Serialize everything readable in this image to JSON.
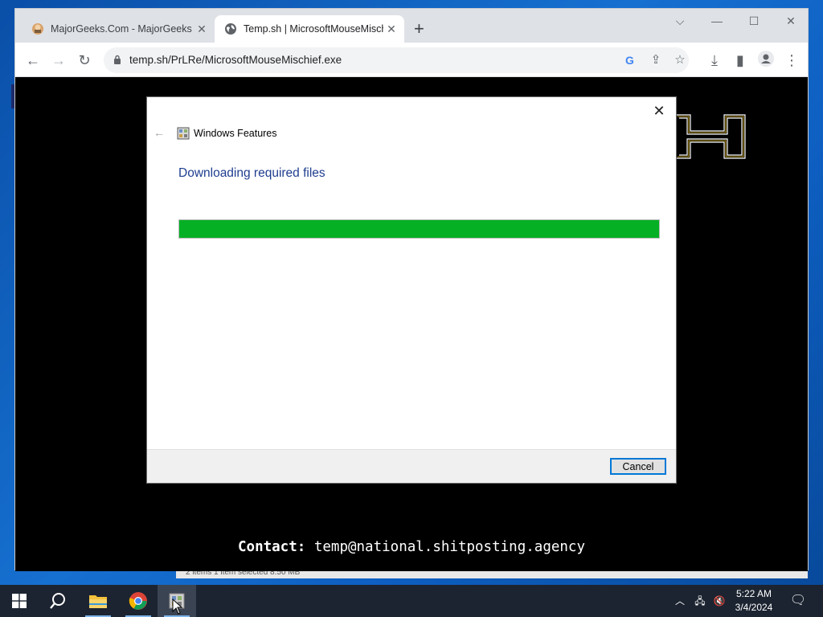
{
  "browser": {
    "tabs": [
      {
        "title": "MajorGeeks.Com - MajorGeeks",
        "active": false
      },
      {
        "title": "Temp.sh | MicrosoftMouseMischief.exe",
        "active": true
      }
    ],
    "url": "temp.sh/PrLRe/MicrosoftMouseMischief.exe",
    "contact_label": "Contact:",
    "contact_email": "temp@national.shitposting.agency"
  },
  "dialog": {
    "title": "Windows Features",
    "heading": "Downloading required files",
    "progress": 1.0,
    "cancel_label": "Cancel"
  },
  "background_window": {
    "status_text": "2 items    1 item selected  8.50 MB"
  },
  "taskbar": {
    "time": "5:22 AM",
    "date": "3/4/2024"
  },
  "colors": {
    "progress_fill": "#06b025",
    "dialog_heading": "#1e3d8f",
    "taskbar_bg": "#1c2431",
    "browser_tabstrip": "#dee1e6"
  }
}
